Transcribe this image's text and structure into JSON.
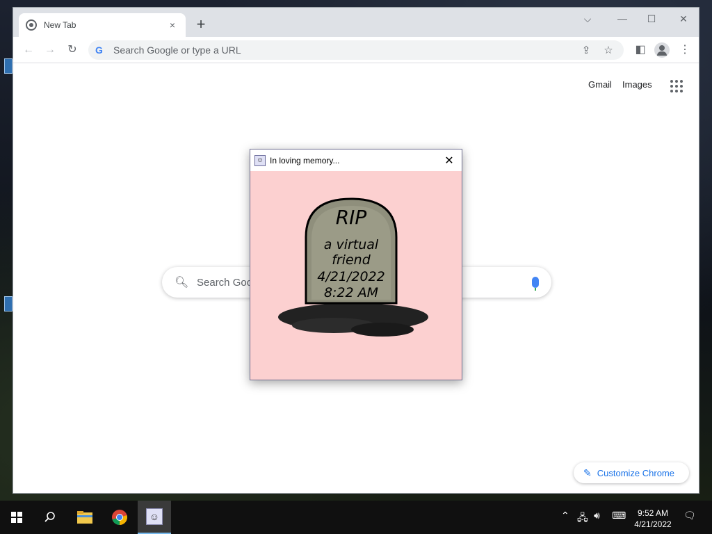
{
  "browser": {
    "tab_title": "New Tab",
    "tab_close": "×",
    "new_tab": "+",
    "omnibox_placeholder": "Search Google or type a URL",
    "omnibox_logo": "G",
    "top_links": [
      "Gmail",
      "Images"
    ],
    "search_placeholder": "Search Goo",
    "customize_label": "Customize Chrome"
  },
  "popup": {
    "title": "In loving memory...",
    "close": "✕",
    "tombstone": {
      "heading": "RIP",
      "lines": [
        "a virtual",
        "friend",
        "4/21/2022",
        "8:22 AM"
      ]
    }
  },
  "taskbar": {
    "time": "9:52 AM",
    "date": "4/21/2022"
  },
  "colors": {
    "popup_bg": "#fcd0d0",
    "accent": "#1a73e8"
  }
}
